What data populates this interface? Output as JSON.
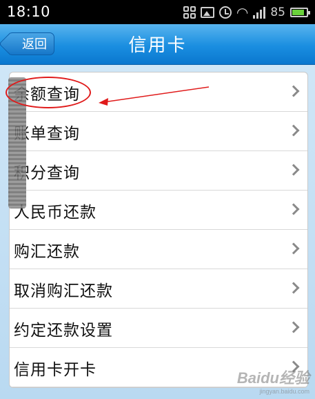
{
  "statusbar": {
    "time": "18:10",
    "battery": "85"
  },
  "header": {
    "back_label": "返回",
    "title": "信用卡"
  },
  "menu": {
    "items": [
      {
        "label": "余额查询"
      },
      {
        "label": "账单查询"
      },
      {
        "label": "积分查询"
      },
      {
        "label": "人民币还款"
      },
      {
        "label": "购汇还款"
      },
      {
        "label": "取消购汇还款"
      },
      {
        "label": "约定还款设置"
      },
      {
        "label": "信用卡开卡"
      }
    ]
  },
  "watermark": {
    "logo": "Baidu经验",
    "url": "jingyan.baidu.com"
  },
  "colors": {
    "titlebar": "#1a8ee0",
    "annotation": "#e01a1a",
    "battery": "#6ad13b"
  }
}
